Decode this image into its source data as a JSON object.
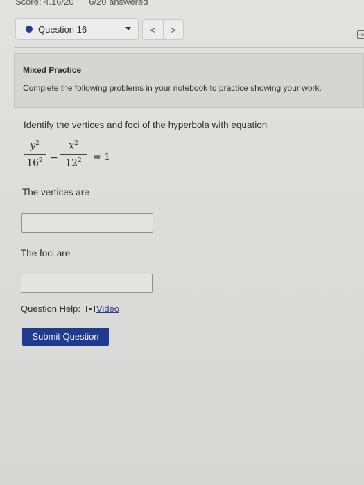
{
  "header": {
    "score": "Score: 4.16/20",
    "answered": "6/20 answered"
  },
  "question_nav": {
    "selected": "Question 16",
    "prev_icon": "chevron-left-icon",
    "next_icon": "chevron-right-icon",
    "prev_glyph": "<",
    "next_glyph": ">"
  },
  "practice": {
    "title": "Mixed Practice",
    "text": "Complete the following problems in your notebook to practice showing your work."
  },
  "problem": {
    "prompt": "Identify the vertices and foci of the hyperbola with equation",
    "equation": {
      "term1_num": "y",
      "term1_num_exp": "2",
      "term1_den": "16",
      "term1_den_exp": "2",
      "operator": "−",
      "term2_num": "x",
      "term2_num_exp": "2",
      "term2_den": "12",
      "term2_den_exp": "2",
      "rhs": "= 1"
    },
    "vertices_label": "The vertices are",
    "vertices_value": "",
    "foci_label": "The foci are",
    "foci_value": ""
  },
  "help": {
    "label": "Question Help:",
    "video_label": "Video",
    "video_icon": "video-icon"
  },
  "submit_label": "Submit Question",
  "colors": {
    "accent": "#1f3a8f",
    "link": "#2a3a8c"
  }
}
